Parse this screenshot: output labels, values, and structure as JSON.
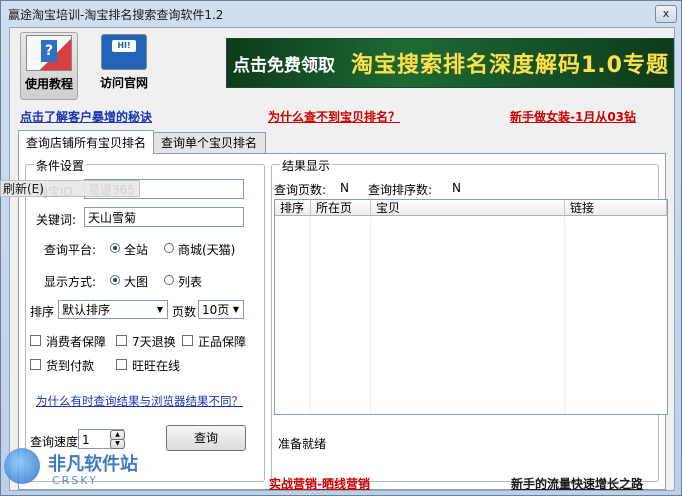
{
  "window": {
    "title": "赢途淘宝培训-淘宝排名搜索查询软件1.2",
    "close_label": "x"
  },
  "toolbar": {
    "help_label": "使用教程",
    "site_label": "访问官网"
  },
  "banner": {
    "lead": "点击免费领取",
    "title": "淘宝搜索排名深度解码1.0专题"
  },
  "links": {
    "secret": "点击了解客户暴增的秘诀",
    "why_not_found": "为什么查不到宝贝排名？",
    "newbie": "新手做女装-1月从03钻"
  },
  "tabs": {
    "all_items": "查询店铺所有宝贝排名",
    "single_item": "查询单个宝贝排名"
  },
  "conditions": {
    "legend": "条件设置",
    "taobao_id_label": "淘宝ID:",
    "taobao_id_value": "易道365",
    "keyword_label": "关键词:",
    "keyword_value": "天山雪菊",
    "platform_label": "查询平台:",
    "platform_all": "全站",
    "platform_mall": "商城(天猫)",
    "display_label": "显示方式:",
    "display_large": "大图",
    "display_list": "列表",
    "sort_label": "排序",
    "sort_value": "默认排序",
    "pages_label": "页数",
    "pages_value": "10页",
    "chk_consumer": "消费者保障",
    "chk_7days": "7天退换",
    "chk_genuine": "正品保障",
    "chk_cod": "货到付款",
    "chk_wangwang": "旺旺在线",
    "why_diff": "为什么有时查询结果与浏览器结果不同？",
    "speed_label": "查询速度",
    "speed_value": "1",
    "query_button": "查询"
  },
  "context_menu": {
    "refresh": "刷新(E)"
  },
  "results": {
    "legend": "结果显示",
    "pages_queried_label": "查询页数:",
    "pages_queried_value": "N",
    "rank_count_label": "查询排序数:",
    "rank_count_value": "N",
    "col_rank": "排序",
    "col_page": "所在页",
    "col_item": "宝贝",
    "col_link": "链接",
    "status": "准备就绪"
  },
  "bottom": {
    "marketing": "实战营销-晒线营销",
    "traffic": "新手的流量快速增长之路"
  },
  "watermark": {
    "main": "非凡软件站",
    "sub": "CRSKY"
  },
  "colors": {
    "link_red": "#cc0000",
    "link_blue": "#1a34b4",
    "banner_green": "#1e6a32",
    "banner_yellow": "#ffe04a"
  }
}
